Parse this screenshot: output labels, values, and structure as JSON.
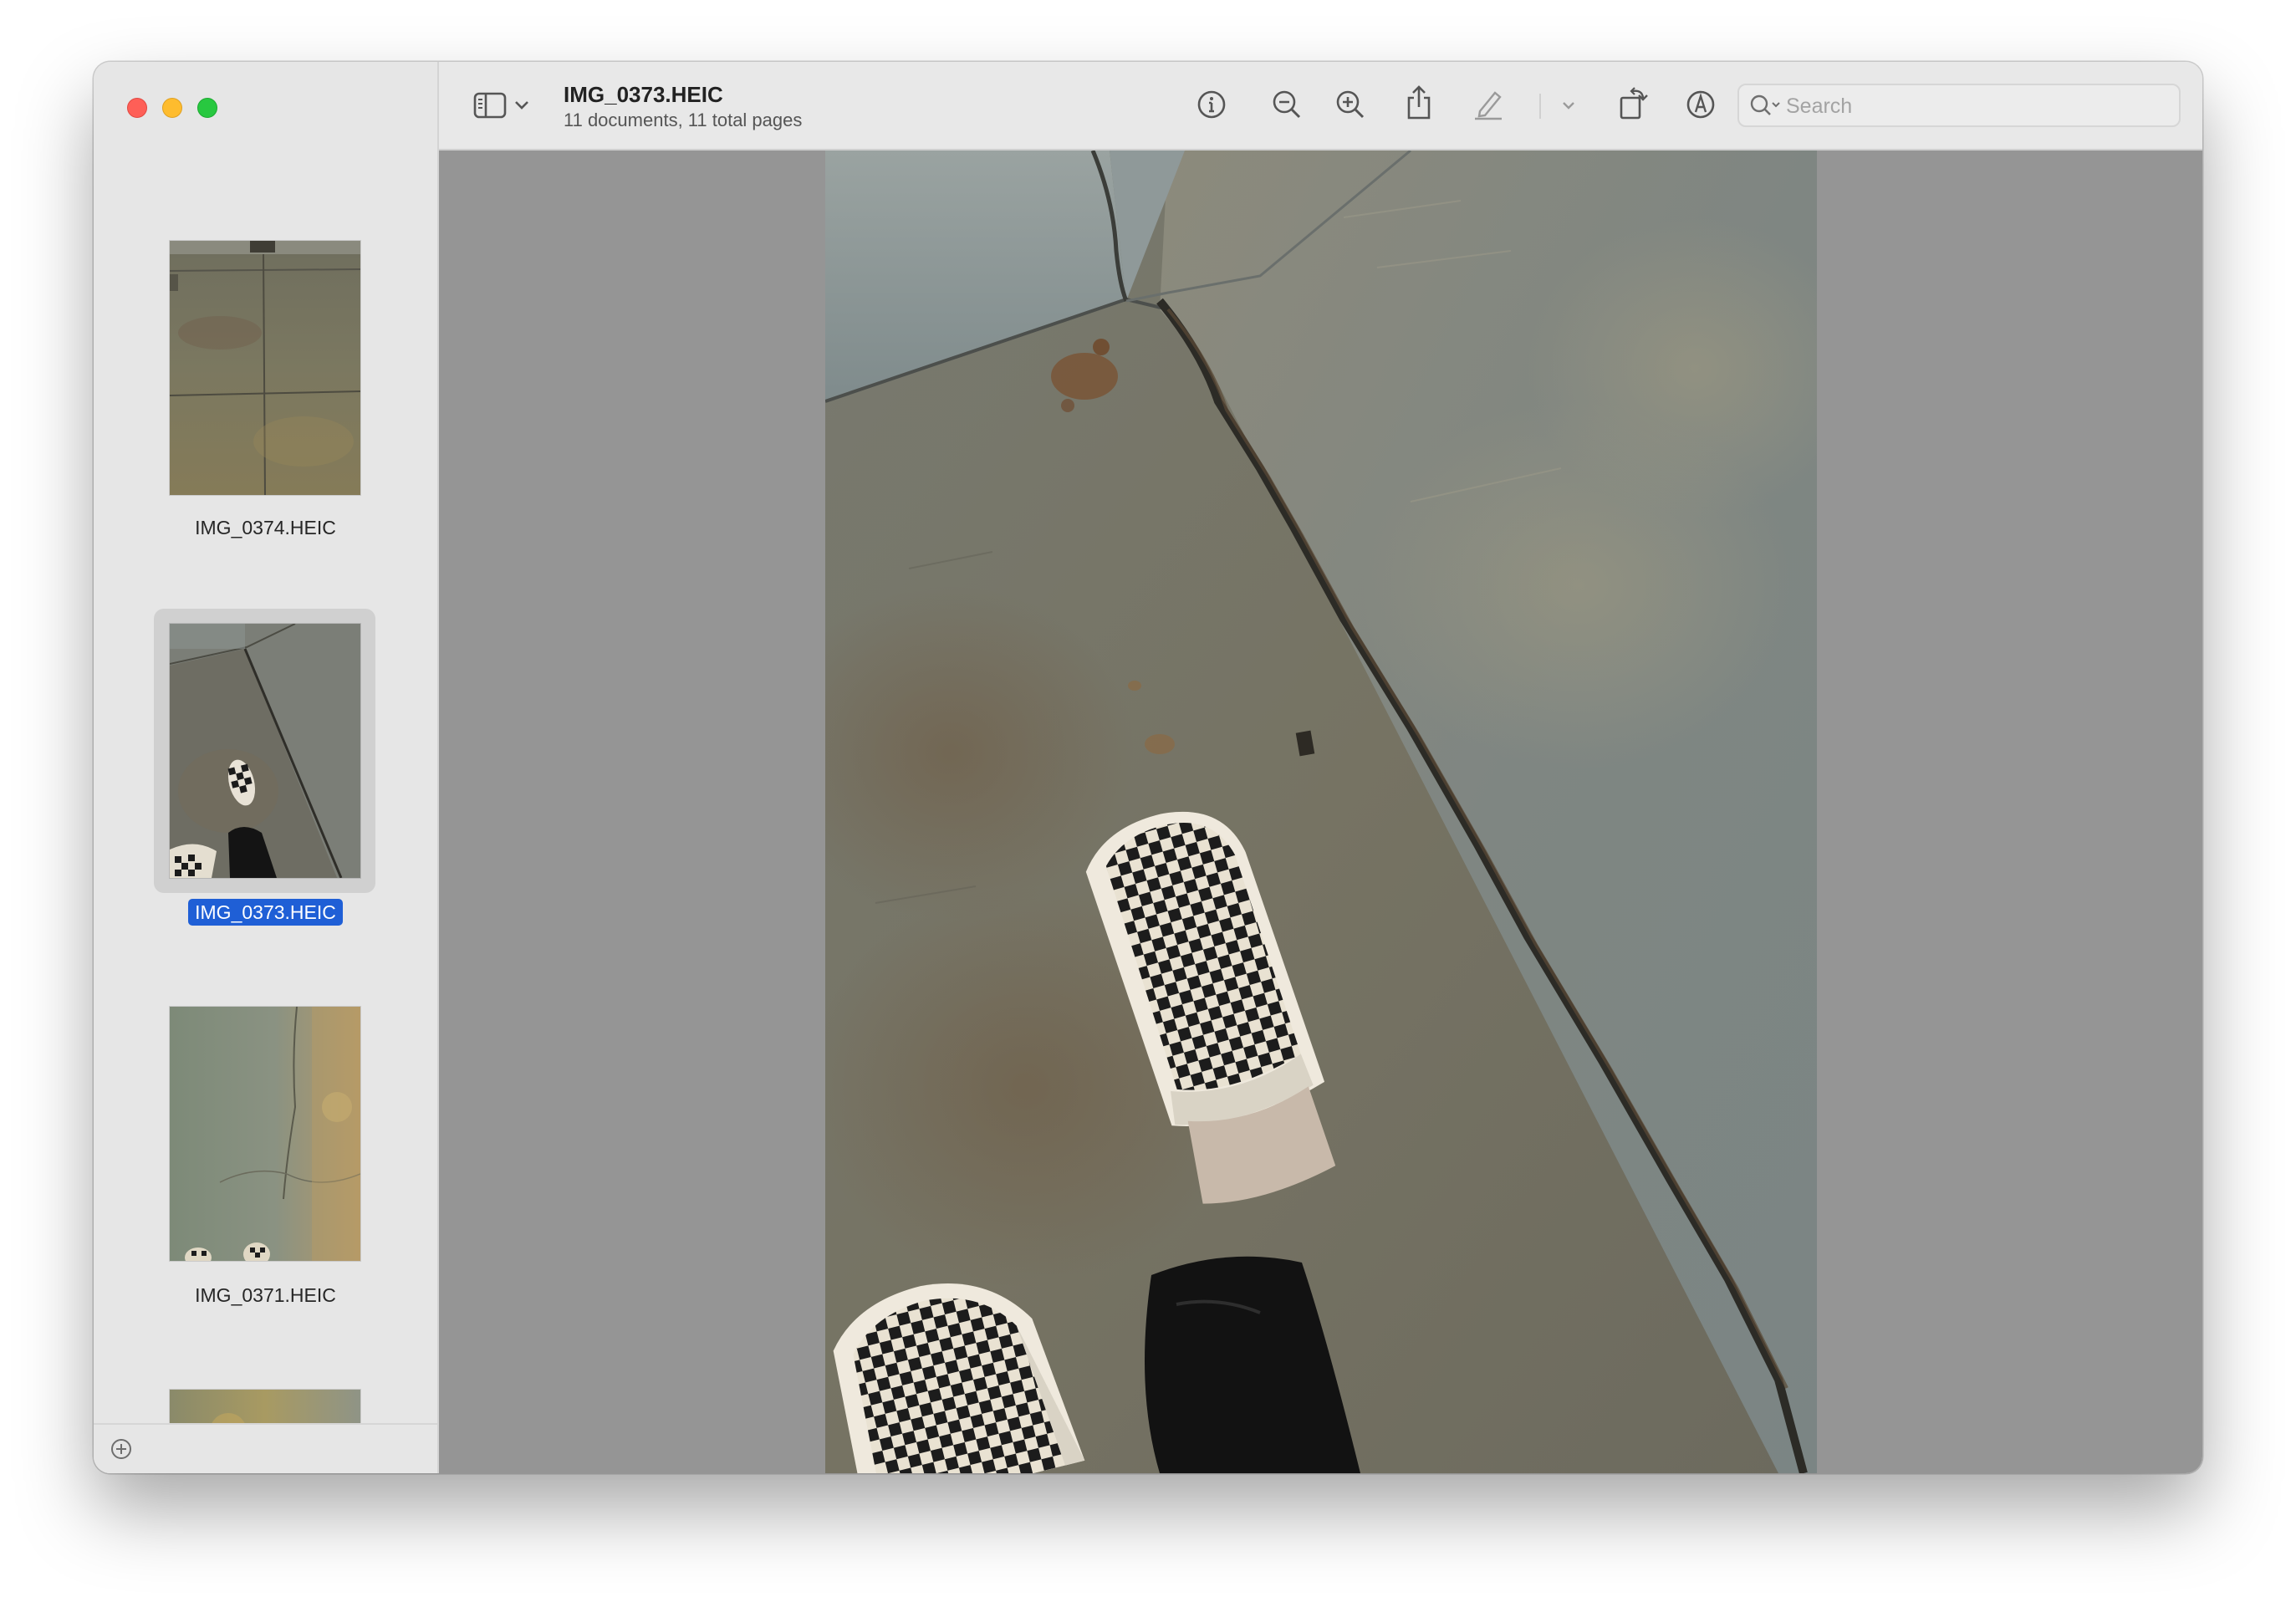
{
  "window": {
    "title": "IMG_0373.HEIC",
    "subtitle": "11 documents, 11 total pages"
  },
  "toolbar": {
    "icons": [
      "sidebar-toggle-icon",
      "chevron-down-icon",
      "info-icon",
      "zoom-out-icon",
      "zoom-in-icon",
      "share-icon",
      "highlight-pen-icon",
      "chevron-down-icon",
      "rotate-icon",
      "markup-icon",
      "signature-form-icon"
    ],
    "search": {
      "placeholder": "Search",
      "value": ""
    }
  },
  "sidebar": {
    "thumbnails": [
      {
        "label": "IMG_0374.HEIC",
        "selected": false
      },
      {
        "label": "IMG_0373.HEIC",
        "selected": true
      },
      {
        "label": "IMG_0371.HEIC",
        "selected": false
      },
      {
        "label": "",
        "selected": false
      }
    ],
    "footer_icon": "add-icon"
  },
  "main": {
    "document": "IMG_0373.HEIC"
  },
  "colors": {
    "selection": "#1f5fd6",
    "content_background": "#959595",
    "traffic_red": "#fe5f57",
    "traffic_yellow": "#febc2e",
    "traffic_green": "#28c840"
  }
}
